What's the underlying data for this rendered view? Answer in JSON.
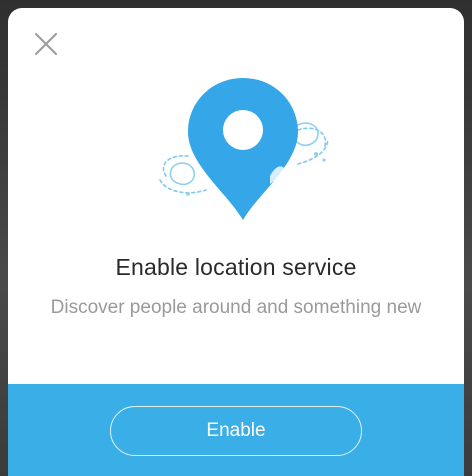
{
  "dialog": {
    "title": "Enable location service",
    "subtitle": "Discover people around and something new",
    "enable_label": "Enable",
    "close_icon": "close-icon",
    "illustration_icon": "location-pin-icon"
  },
  "colors": {
    "accent": "#3aaee6",
    "pin": "#35a7e8",
    "title": "#2a2a2a",
    "subtitle": "#9a9a9a"
  }
}
